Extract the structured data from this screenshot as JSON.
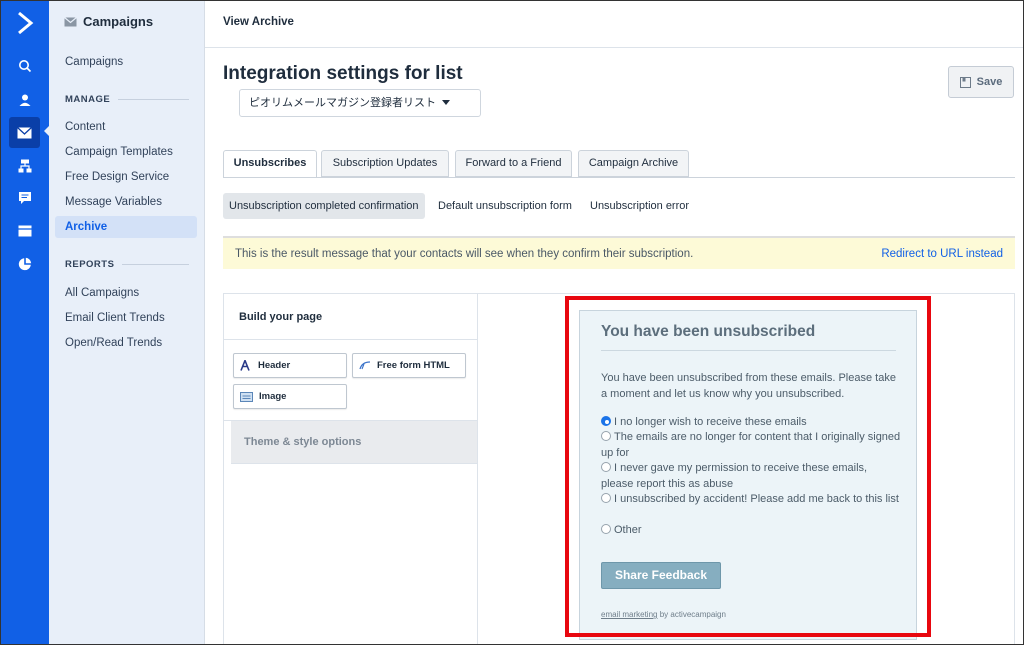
{
  "topbar": {
    "breadcrumb": "View Archive"
  },
  "sidebar": {
    "title": "Campaigns",
    "top_link": "Campaigns",
    "manage_label": "MANAGE",
    "manage_items": [
      "Content",
      "Campaign Templates",
      "Free Design Service",
      "Message Variables",
      "Archive"
    ],
    "active_item": "Archive",
    "reports_label": "REPORTS",
    "report_items": [
      "All Campaigns",
      "Email Client Trends",
      "Open/Read Trends"
    ]
  },
  "rail": {
    "icons": [
      "logo-icon",
      "search-icon",
      "contacts-icon",
      "campaigns-icon",
      "automations-icon",
      "conversations-icon",
      "site-icon",
      "reports-icon"
    ],
    "active": "campaigns-icon",
    "color": "#1160e6"
  },
  "main": {
    "title": "Integration settings for list",
    "list_selected": "ピオリムメールマガジン登録者リスト",
    "save_label": "Save",
    "tabs": [
      "Unsubscribes",
      "Subscription Updates",
      "Forward to a Friend",
      "Campaign Archive"
    ],
    "active_tab": "Unsubscribes",
    "subtabs": [
      "Unsubscription completed confirmation",
      "Default unsubscription form",
      "Unsubscription error"
    ],
    "active_subtab": "Unsubscription completed confirmation",
    "notice": "This is the result message that your contacts will see when they confirm their subscription.",
    "redirect_link": "Redirect to URL instead"
  },
  "builder": {
    "title": "Build your page",
    "blocks": [
      "Header",
      "Free form HTML",
      "Image"
    ],
    "theme_label": "Theme & style options"
  },
  "preview": {
    "title": "You have been unsubscribed",
    "body": "You have been unsubscribed from these emails. Please take a moment and let us know why you unsubscribed.",
    "options": [
      "I no longer wish to receive these emails",
      "The emails are no longer for content that I originally signed up for",
      "I never gave my permission to receive these emails, please report this as abuse",
      "I unsubscribed by accident! Please add me back to this list",
      "Other"
    ],
    "selected_option": "I no longer wish to receive these emails",
    "button": "Share Feedback",
    "footer_link": "email marketing",
    "footer_rest": " by activecampaign",
    "highlight_color": "#e8070f"
  }
}
